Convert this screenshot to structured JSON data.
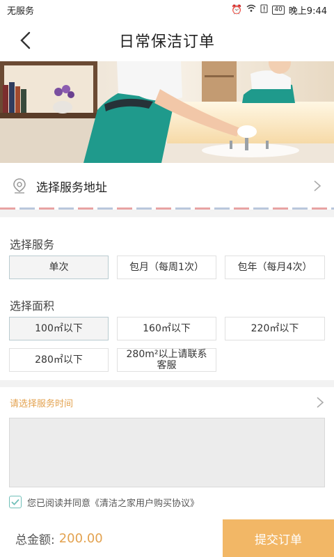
{
  "status_bar": {
    "carrier": "无服务",
    "battery": "40",
    "time": "晚上9:44"
  },
  "header": {
    "title": "日常保洁订单"
  },
  "address": {
    "label": "选择服务地址"
  },
  "service": {
    "title": "选择服务",
    "options": [
      "单次",
      "包月（每周1次）",
      "包年（每月4次）"
    ],
    "selected": "单次"
  },
  "area": {
    "title": "选择面积",
    "options": [
      "100㎡以下",
      "160㎡以下",
      "220㎡以下",
      "280㎡以下",
      "280m²以上请联系客服"
    ],
    "selected": "100㎡以下"
  },
  "time": {
    "label": "请选择服务时间"
  },
  "notes": {
    "value": ""
  },
  "agreement": {
    "text": "您已阅读并同意《清洁之家用户购买协议》",
    "checked": true
  },
  "footer": {
    "total_label": "总金额:",
    "total_value": "200.00",
    "submit_label": "提交订单"
  },
  "colors": {
    "accent": "#f2b766",
    "highlight_text": "#e3a24f",
    "check": "#6fbfb8"
  }
}
